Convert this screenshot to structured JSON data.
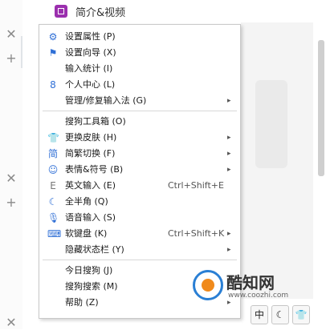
{
  "window": {
    "title": "简介&视频"
  },
  "side": {
    "icons": [
      "close-icon",
      "plus-icon",
      "close-icon",
      "plus-icon",
      "close-icon"
    ]
  },
  "menu": {
    "items": [
      {
        "icon": "gear-icon",
        "label": "设置属性 (P)",
        "shortcut": "",
        "submenu": false
      },
      {
        "icon": "flag-icon",
        "label": "设置向导 (X)",
        "shortcut": "",
        "submenu": false
      },
      {
        "icon": "",
        "label": "输入统计 (I)",
        "shortcut": "",
        "submenu": false
      },
      {
        "icon": "user-icon",
        "label": "个人中心 (L)",
        "shortcut": "",
        "submenu": false
      },
      {
        "icon": "",
        "label": "管理/修复输入法 (G)",
        "shortcut": "",
        "submenu": true
      },
      {
        "icon": "",
        "label": "搜狗工具箱 (O)",
        "shortcut": "",
        "submenu": false
      },
      {
        "icon": "shirt-icon",
        "label": "更换皮肤 (H)",
        "shortcut": "",
        "submenu": true
      },
      {
        "icon": "simplified-icon",
        "label": "简繁切换 (F)",
        "shortcut": "",
        "submenu": true
      },
      {
        "icon": "smiley-icon",
        "label": "表情&符号 (B)",
        "shortcut": "",
        "submenu": true
      },
      {
        "icon": "english-icon",
        "label": "英文输入 (E)",
        "shortcut": "Ctrl+Shift+E",
        "submenu": false
      },
      {
        "icon": "moon-icon",
        "label": "全半角 (Q)",
        "shortcut": "",
        "submenu": false
      },
      {
        "icon": "microphone-icon",
        "label": "语音输入 (S)",
        "shortcut": "",
        "submenu": false
      },
      {
        "icon": "keyboard-icon",
        "label": "软键盘 (K)",
        "shortcut": "Ctrl+Shift+K",
        "submenu": true
      },
      {
        "icon": "",
        "label": "隐藏状态栏 (Y)",
        "shortcut": "",
        "submenu": true
      },
      {
        "icon": "",
        "label": "今日搜狗 (J)",
        "shortcut": "",
        "submenu": false
      },
      {
        "icon": "",
        "label": "搜狗搜索 (M)",
        "shortcut": "",
        "submenu": false
      },
      {
        "icon": "",
        "label": "帮助 (Z)",
        "shortcut": "",
        "submenu": true
      }
    ],
    "glyphs": {
      "gear": "⚙",
      "flag": "⚑",
      "user": "8",
      "shirt": "👕",
      "simplified": "简",
      "smiley": "☺",
      "english": "E",
      "moon": "☾",
      "microphone": "🎙",
      "keyboard": "⌨",
      "arrow": "▸"
    }
  },
  "watermark": {
    "title": "酷知网",
    "subtitle": "www.coozhi.com"
  },
  "statusbar": {
    "buttons": [
      "中",
      "☾",
      "👕"
    ]
  },
  "colors": {
    "accent": "#2f6fd6",
    "title_icon": "#9b2fae"
  }
}
